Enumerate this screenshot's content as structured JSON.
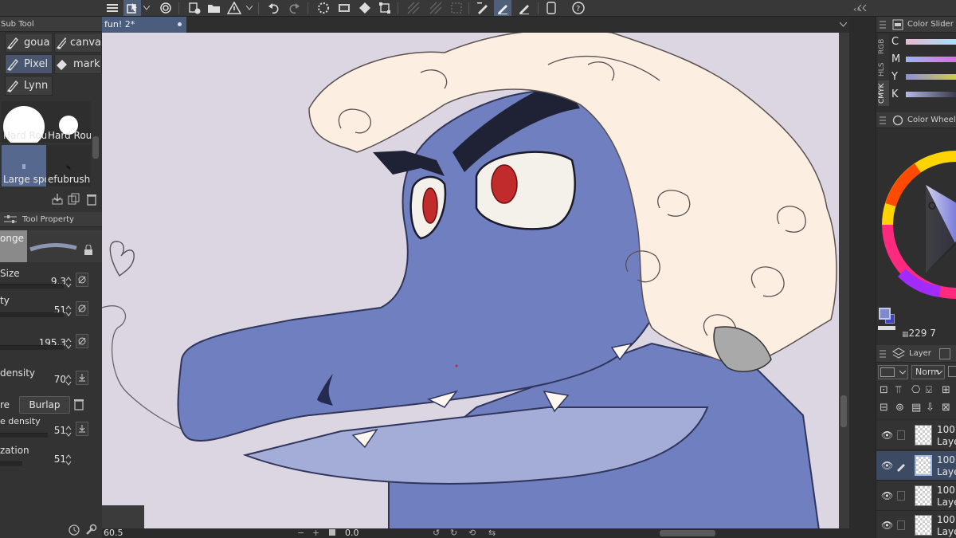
{
  "top_bar": {
    "icons": [
      "menu-icon",
      "select-layer-icon",
      "lasso-icon",
      "new-layer-icon",
      "open-folder-icon",
      "warning-icon",
      "undo-icon",
      "redo-icon",
      "spinner-icon",
      "fill-icon",
      "transform-icon",
      "hatch-icon",
      "grid-icon",
      "pen-icon",
      "brush-icon",
      "pencil-icon",
      "phone-icon",
      "help-icon"
    ]
  },
  "sub_tool": {
    "title": "Sub Tool",
    "tools": [
      {
        "label": "goua",
        "icon": "brush-nib-icon"
      },
      {
        "label": "canva",
        "icon": "brush-nib-icon"
      },
      {
        "label": "Pixel",
        "icon": "brush-nib-icon"
      },
      {
        "label": "mark",
        "icon": "marker-icon"
      },
      {
        "label": "Lynn",
        "icon": "brush-nib-icon"
      }
    ],
    "brushes": [
      {
        "label": "Hard Rou"
      },
      {
        "label": "Hard Rou"
      },
      {
        "label": "Large spo"
      },
      {
        "label": "efubrush"
      }
    ]
  },
  "tool_property": {
    "title": "Tool Property",
    "preset_label": "onge",
    "rows": [
      {
        "label": "Size",
        "value": "9.3"
      },
      {
        "label": "ty",
        "value": "51"
      },
      {
        "label": "",
        "value": "195.3"
      },
      {
        "label": "density",
        "value": "70"
      },
      {
        "label": "re",
        "value": "Burlap"
      },
      {
        "label": "e density",
        "value": "51"
      },
      {
        "label": "zation",
        "value": "51"
      }
    ]
  },
  "canvas": {
    "tab_title": "fun! 2*",
    "colors": {
      "background": "#dcd6e3",
      "skin": "#6f7fbf",
      "wig": "#fcefe2",
      "eye_red": "#c22b2b"
    }
  },
  "status_bar": {
    "zoom": "60.5",
    "angle": "0.0"
  },
  "color_slider": {
    "title": "Color Slider",
    "tabs": [
      "RGB",
      "HLS",
      "CMYK"
    ],
    "rows": [
      "C",
      "M",
      "Y",
      "K"
    ]
  },
  "color_wheel": {
    "title": "Color Wheel",
    "value_display": "229",
    "value_suffix": "7"
  },
  "layer_panel": {
    "title": "Layer",
    "blend_mode": "Norm",
    "layers": [
      {
        "opacity": "100",
        "name": "Laye"
      },
      {
        "opacity": "100",
        "name": "Laye"
      },
      {
        "opacity": "100",
        "name": "Laye"
      },
      {
        "opacity": "100",
        "name": "Laye"
      }
    ]
  }
}
